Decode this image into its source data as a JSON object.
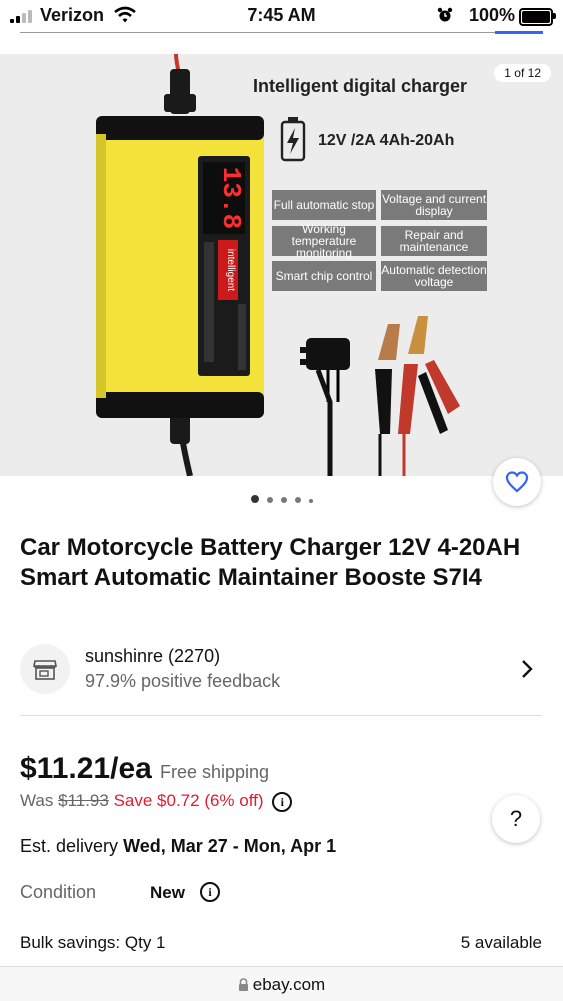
{
  "status": {
    "carrier": "Verizon",
    "time": "7:45 AM",
    "battery": "100%"
  },
  "hero": {
    "counter": "1 of 12",
    "title": "Intelligent digital charger",
    "spec": "12V /2A 4Ah-20Ah",
    "display_reading": "13.8",
    "device_label": "intelligent",
    "features": [
      "Full automatic stop",
      "Voltage and current display",
      "Working temperature monitoring",
      "Repair and maintenance",
      "Smart chip control",
      "Automatic detection voltage"
    ]
  },
  "listing": {
    "title": "Car Motorcycle Battery Charger 12V 4-20AH Smart Automatic Maintainer Booste S7I4",
    "seller_name": "sunshinre (2270)",
    "seller_feedback": "97.9% positive feedback",
    "price": "$11.21/ea",
    "shipping": "Free shipping",
    "was_label": "Was",
    "was_price": "$11.93",
    "save_text": "Save $0.72 (6% off)",
    "delivery_label": "Est. delivery",
    "delivery_dates": "Wed, Mar 27 - Mon, Apr 1",
    "condition_label": "Condition",
    "condition_value": "New",
    "bulk_label": "Bulk savings: Qty 1",
    "available": "5 available",
    "help_label": "?"
  },
  "browser": {
    "url": "ebay.com"
  },
  "colors": {
    "accent_blue": "#3665f3",
    "save_red": "#dd1e31",
    "charger_yellow": "#f2e23a"
  }
}
